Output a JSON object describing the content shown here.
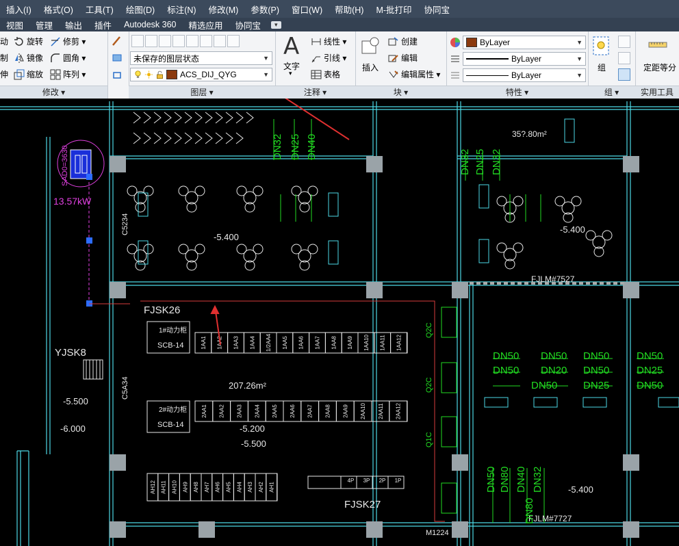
{
  "menubar": [
    "插入(I)",
    "格式(O)",
    "工具(T)",
    "绘图(D)",
    "标注(N)",
    "修改(M)",
    "参数(P)",
    "窗口(W)",
    "帮助(H)",
    "M-批打印",
    "协同宝"
  ],
  "tabs": [
    "视图",
    "管理",
    "输出",
    "插件",
    "Autodesk 360",
    "精选应用",
    "协同宝"
  ],
  "modify": {
    "title": "修改 ▾",
    "items": [
      "动",
      "旋转",
      "修剪 ▾",
      "制",
      "镜像",
      "圆角 ▾",
      "伸",
      "缩放",
      "阵列 ▾"
    ]
  },
  "layer": {
    "title": "图层 ▾",
    "state_value": "未保存的图层状态",
    "current_layer": "ACS_DIJ_QYG"
  },
  "annotation": {
    "title": "注释 ▾",
    "text_label": "文字",
    "linear": "线性 ▾",
    "leader": "引线 ▾",
    "table": "表格"
  },
  "block": {
    "title": "块 ▾",
    "insert": "插入",
    "create": "创建",
    "edit": "编辑",
    "edit_attr": "编辑属性 ▾"
  },
  "properties": {
    "title": "特性 ▾",
    "color": "ByLayer",
    "linetype": "ByLayer",
    "lineweight": "ByLayer"
  },
  "group": {
    "title": "组 ▾",
    "label": "组"
  },
  "utilities": {
    "title": "实用工具",
    "measure": "定距等分"
  },
  "drawing": {
    "accent_cyan": "#4dd9e6",
    "accent_green": "#22dd22",
    "room_labels": [
      "FJSK26",
      "YJSK8",
      "FJSK27",
      "FJLM#7527",
      "FJLM#7727"
    ],
    "areas": [
      "207.26m²",
      "35?.80m²"
    ],
    "elevations": [
      "-5.400",
      "-5.400",
      "-5.500",
      "-6.000",
      "-5.200",
      "-5.500",
      "-5.400"
    ],
    "power": "13.57kW",
    "board1": "1#动力柜",
    "board1_model": "SCB-14",
    "board2": "2#动力柜",
    "board2_model": "SCB-14",
    "row1_cells": [
      "1AA1",
      "1AA2",
      "1AA3",
      "1AA4",
      "1/2AA4",
      "1AA5",
      "1AA6",
      "1AA7",
      "1AA8",
      "1AA9",
      "1AA10",
      "1AA11",
      "1AA12"
    ],
    "row2_cells": [
      "2AA1",
      "2AA2",
      "2AA3",
      "2AA4",
      "2AA5",
      "2AA6",
      "2AA7",
      "2AA8",
      "2AA9",
      "2AA10",
      "2AA11",
      "2AA12"
    ],
    "row3_cells": [
      "AH12",
      "AH11",
      "AH10",
      "AH9",
      "AH8",
      "AH7",
      "AH6",
      "AH5",
      "AH4",
      "AH3",
      "AH2",
      "AH1"
    ],
    "phase_cells": [
      "4P",
      "3P",
      "2P",
      "1P"
    ],
    "dn_labels": [
      "DN50",
      "DN50",
      "DN50",
      "DN50",
      "DN50",
      "DN20",
      "DN50",
      "DN25",
      "DN50",
      "DN25",
      "DN50",
      "DN80",
      "DN50",
      "DN80",
      "DN40",
      "DN32",
      "DN32",
      "DN25",
      "DN40",
      "DN32",
      "DN25",
      "DN32"
    ],
    "side_labels": [
      "C5234",
      "C5A34",
      "Q2C",
      "Q2C",
      "Q1C",
      "SAD0=3630",
      "M1224"
    ]
  }
}
